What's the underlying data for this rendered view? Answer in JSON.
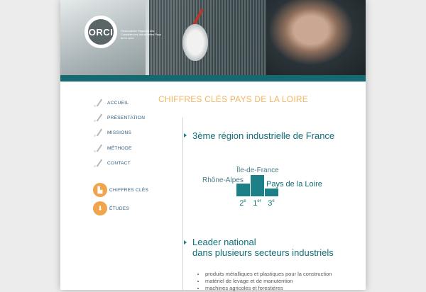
{
  "header": {
    "logo_text": "ORCI",
    "logo_caption": "Observatoire Régional des Compétences Industrielles Pays de la Loire"
  },
  "nav": {
    "items": [
      {
        "label": "ACCUEIL"
      },
      {
        "label": "PRÉSENTATION"
      },
      {
        "label": "MISSIONS"
      },
      {
        "label": "MÉTHODE"
      },
      {
        "label": "CONTACT"
      }
    ],
    "circles": [
      {
        "label": "CHIFFRES CLÉS",
        "icon": "factory-icon",
        "glyph": "▙"
      },
      {
        "label": "ÉTUDES",
        "icon": "download-icon",
        "glyph": "⬇"
      }
    ]
  },
  "page_title": "CHIFFRES CLÉS PAYS DE LA LOIRE",
  "section1": {
    "title": "3ème région industrielle de France"
  },
  "ranking": {
    "bar_color": "#1d7f88",
    "items": [
      {
        "name": "Rhône-Alpes",
        "rank": "2",
        "suffix": "e",
        "level": 0.6
      },
      {
        "name": "Île-de-France",
        "rank": "1",
        "suffix": "er",
        "level": 1.0
      },
      {
        "name": "Pays de la Loire",
        "rank": "3",
        "suffix": "e",
        "level": 0.35
      }
    ]
  },
  "section2": {
    "title_line1": "Leader national",
    "title_line2": "dans plusieurs secteurs industriels",
    "items": [
      "produits métalliques et plastiques pour la construction",
      "matériel de levage et de manutention",
      "machines agricoles et forestières"
    ]
  },
  "colors": {
    "accent_teal": "#146a70",
    "title_orange": "#f2b563",
    "nav_blue": "#2c5a7e",
    "circle_orange": "#f0a44b"
  }
}
